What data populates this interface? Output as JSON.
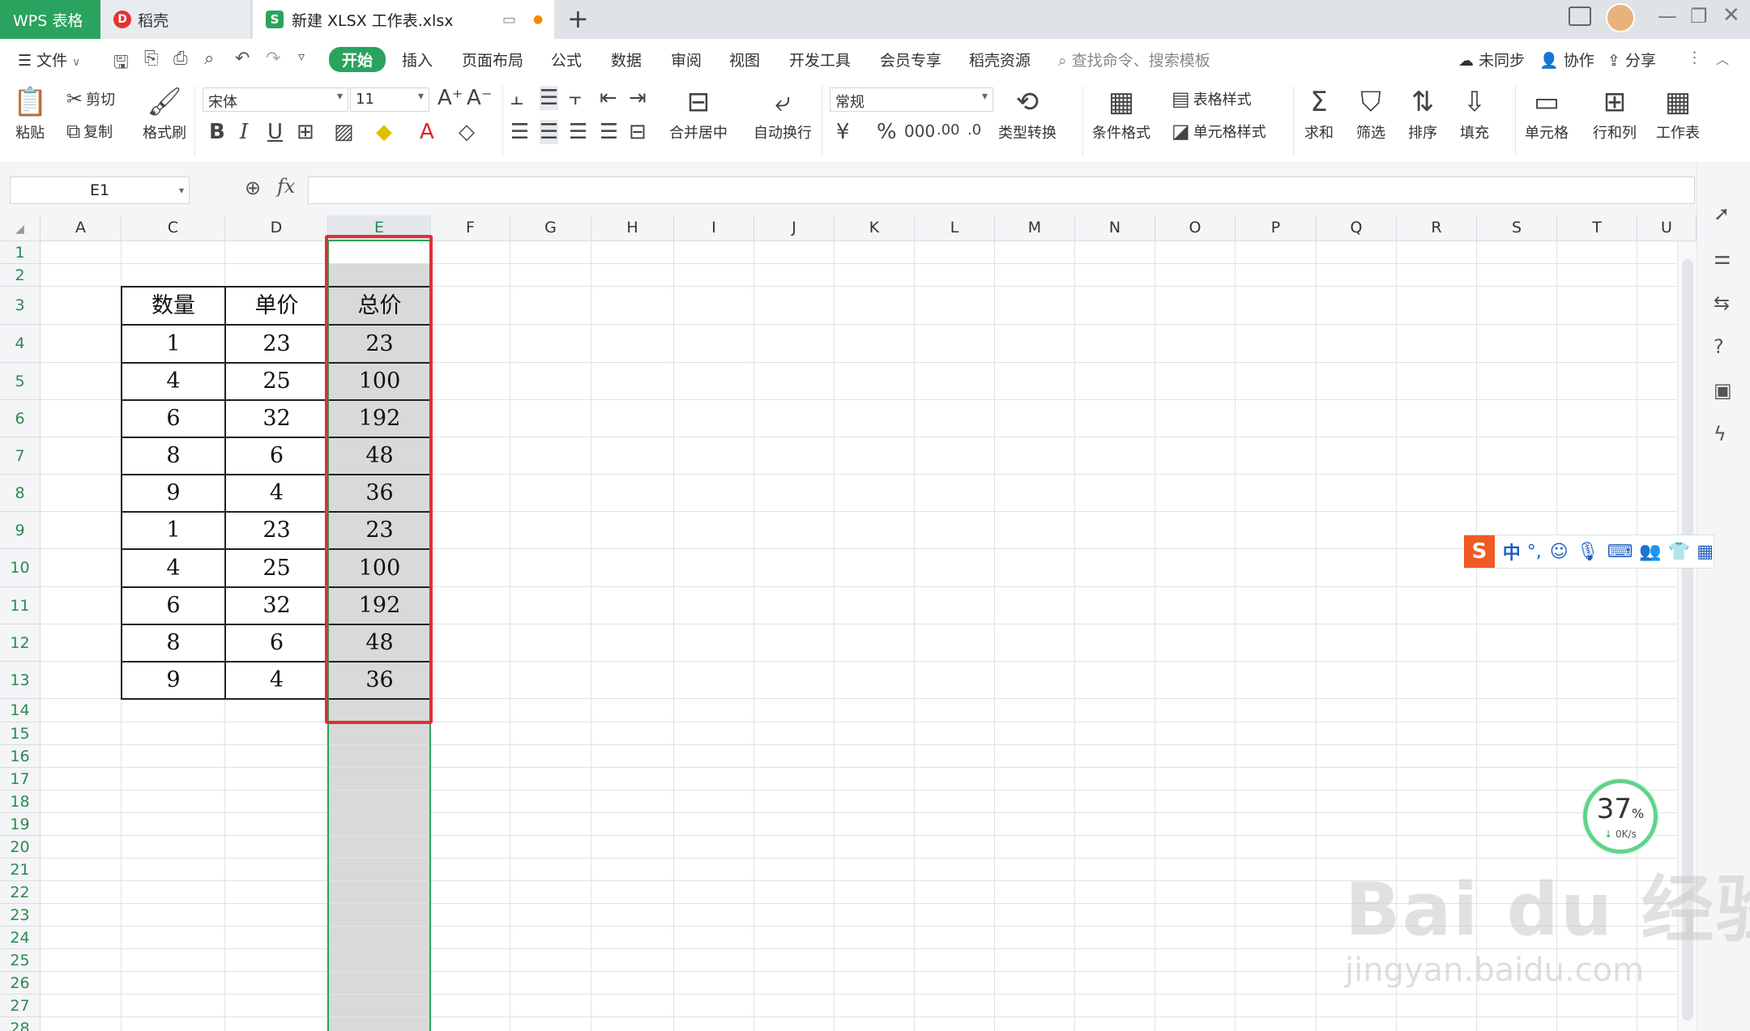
{
  "titlebar": {
    "tab_wps": "WPS 表格",
    "tab_daoke": "稻壳",
    "tab_file": "新建 XLSX 工作表.xlsx",
    "add_tab": "+"
  },
  "menu": {
    "file": "文件",
    "items": [
      "开始",
      "插入",
      "页面布局",
      "公式",
      "数据",
      "审阅",
      "视图",
      "开发工具",
      "会员专享",
      "稻壳资源"
    ],
    "search": "查找命令、搜索模板",
    "unsynced": "未同步",
    "collab": "协作",
    "share": "分享"
  },
  "ribbon": {
    "paste": "粘贴",
    "cut": "剪切",
    "copy": "复制",
    "format_painter": "格式刷",
    "font_name": "宋体",
    "font_size": "11",
    "merge_center": "合并居中",
    "wrap_text": "自动换行",
    "number_format": "常规",
    "type_convert": "类型转换",
    "cond_format": "条件格式",
    "table_style": "表格样式",
    "cell_style": "单元格样式",
    "sum": "求和",
    "filter": "筛选",
    "sort": "排序",
    "fill": "填充",
    "cell": "单元格",
    "row_col": "行和列",
    "worksheet": "工作表"
  },
  "formula_bar": {
    "name_box": "E1",
    "fx": "fx"
  },
  "sheet": {
    "columns": [
      "A",
      "C",
      "D",
      "E",
      "F",
      "G",
      "H",
      "I",
      "J",
      "K",
      "L",
      "M",
      "N",
      "O",
      "P",
      "Q",
      "R",
      "S",
      "T",
      "U"
    ],
    "rows": [
      "1",
      "2",
      "3",
      "4",
      "5",
      "6",
      "7",
      "8",
      "9",
      "10",
      "11",
      "12",
      "13",
      "14",
      "15",
      "16",
      "17",
      "18",
      "19",
      "20",
      "21",
      "22",
      "23",
      "24",
      "25",
      "26",
      "27",
      "28"
    ],
    "headers": [
      "数量",
      "单价",
      "总价"
    ],
    "data": [
      [
        "1",
        "23",
        "23"
      ],
      [
        "4",
        "25",
        "100"
      ],
      [
        "6",
        "32",
        "192"
      ],
      [
        "8",
        "6",
        "48"
      ],
      [
        "9",
        "4",
        "36"
      ],
      [
        "1",
        "23",
        "23"
      ],
      [
        "4",
        "25",
        "100"
      ],
      [
        "6",
        "32",
        "192"
      ],
      [
        "8",
        "6",
        "48"
      ],
      [
        "9",
        "4",
        "36"
      ]
    ]
  },
  "ime": {
    "mode": "中",
    "punct": "°,"
  },
  "net_widget": {
    "percent": "37",
    "unit": "%",
    "speed": "0K/s"
  },
  "watermark": {
    "brand": "Bai du 经验",
    "url": "jingyan.baidu.com"
  },
  "colors": {
    "accent": "#2aa35f",
    "highlight_box": "#e03030",
    "selection_fill": "#d9d9d9"
  }
}
